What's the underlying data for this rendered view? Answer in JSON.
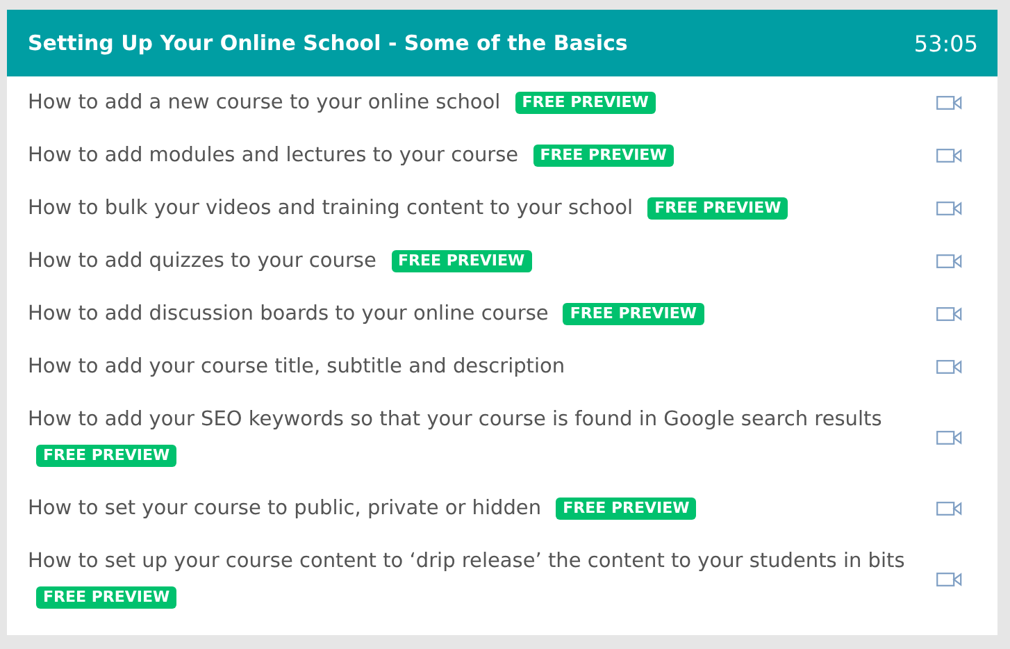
{
  "section": {
    "title": "Setting Up Your Online School - Some of the Basics",
    "duration": "53:05"
  },
  "lectures": [
    {
      "title": "How to add a new course to your online school",
      "badge": "FREE PREVIEW"
    },
    {
      "title": "How to add modules and lectures to your course",
      "badge": "FREE PREVIEW"
    },
    {
      "title": "How to bulk your videos and training content to your school",
      "badge": "FREE PREVIEW"
    },
    {
      "title": "How to add quizzes to your course",
      "badge": "FREE PREVIEW"
    },
    {
      "title": "How to add discussion boards to your online course",
      "badge": "FREE PREVIEW"
    },
    {
      "title": "How to add your course title, subtitle and description"
    },
    {
      "title": "How to add your SEO keywords so that your course is found in Google search results",
      "badge": "FREE PREVIEW"
    },
    {
      "title": "How to set your course to public, private or hidden",
      "badge": "FREE PREVIEW"
    },
    {
      "title": "How to set up your course content to ‘drip release’ the content to your students in bits",
      "badge": "FREE PREVIEW"
    }
  ]
}
